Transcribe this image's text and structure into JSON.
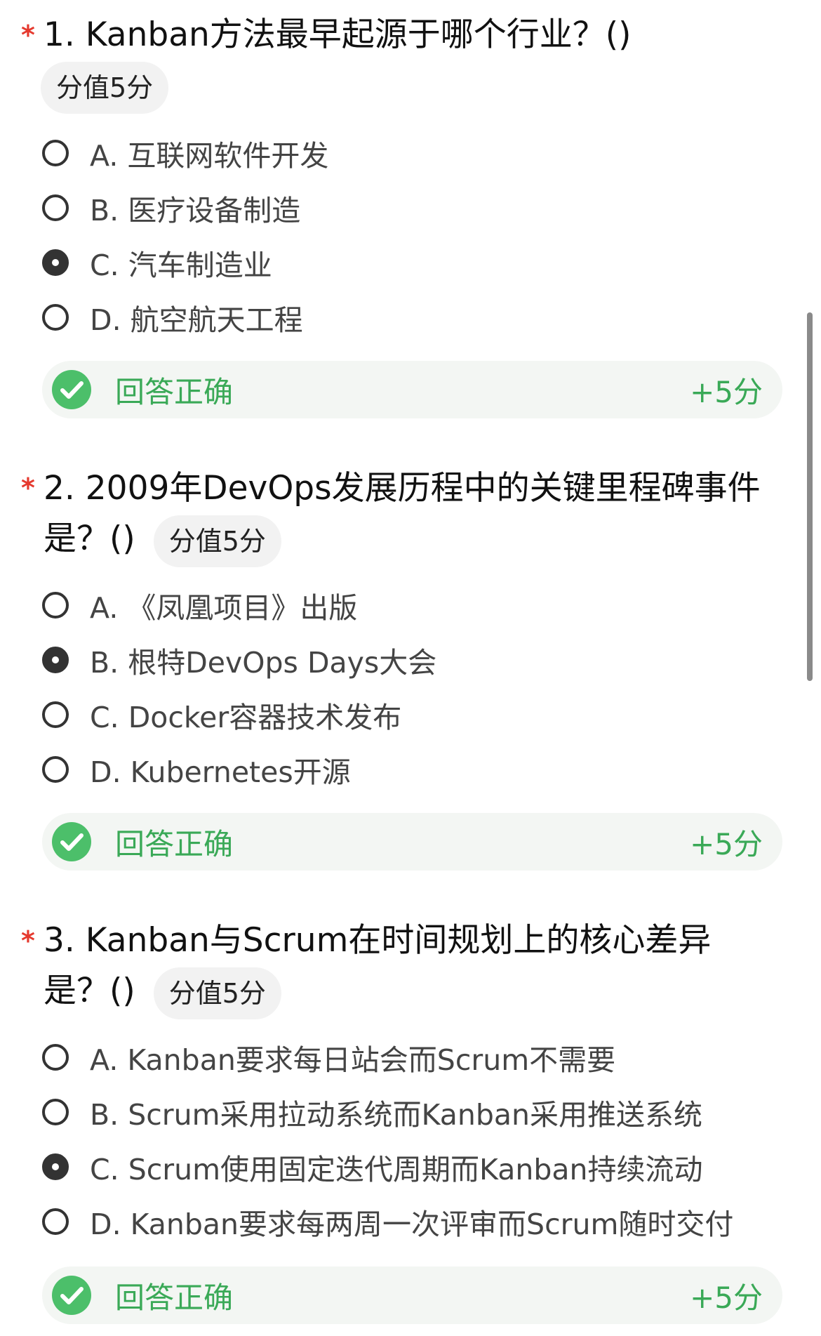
{
  "questions": [
    {
      "required_mark": "*",
      "title": "1. Kanban方法最早起源于哪个行业？()",
      "score": "分值5分",
      "options": [
        {
          "label": "A. 互联网软件开发",
          "selected": false
        },
        {
          "label": "B. 医疗设备制造",
          "selected": false
        },
        {
          "label": "C. 汽车制造业",
          "selected": true
        },
        {
          "label": "D. 航空航天工程",
          "selected": false
        }
      ],
      "result": {
        "text": "回答正确",
        "points": "+5分"
      }
    },
    {
      "required_mark": "*",
      "title": "2. 2009年DevOps发展历程中的关键里程碑事件是？()",
      "score": "分值5分",
      "options": [
        {
          "label": "A. 《凤凰项目》出版",
          "selected": false
        },
        {
          "label": "B. 根特DevOps Days大会",
          "selected": true
        },
        {
          "label": "C. Docker容器技术发布",
          "selected": false
        },
        {
          "label": "D. Kubernetes开源",
          "selected": false
        }
      ],
      "result": {
        "text": "回答正确",
        "points": "+5分"
      }
    },
    {
      "required_mark": "*",
      "title": "3. Kanban与Scrum在时间规划上的核心差异是？()",
      "score": "分值5分",
      "options": [
        {
          "label": "A. Kanban要求每日站会而Scrum不需要",
          "selected": false
        },
        {
          "label": "B. Scrum采用拉动系统而Kanban采用推送系统",
          "selected": false
        },
        {
          "label": "C. Scrum使用固定迭代周期而Kanban持续流动",
          "selected": true
        },
        {
          "label": "D. Kanban要求每两周一次评审而Scrum随时交付",
          "selected": false
        }
      ],
      "result": {
        "text": "回答正确",
        "points": "+5分"
      }
    }
  ],
  "colors": {
    "required": "#e5392e",
    "correct": "#3aa957",
    "correct_icon_bg": "#4cbf6a",
    "chip_bg": "#f2f2f2"
  },
  "icons": {
    "result": "check-circle-icon"
  }
}
